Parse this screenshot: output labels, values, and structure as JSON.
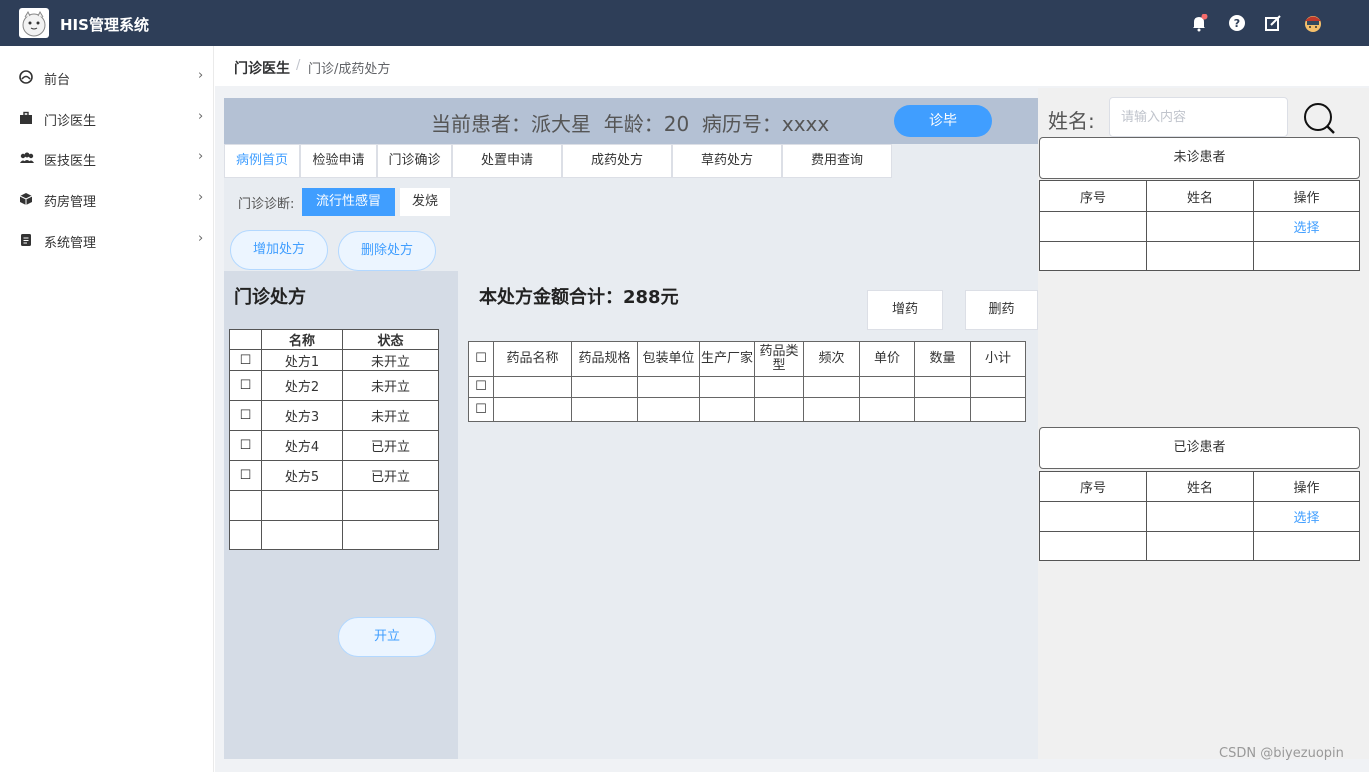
{
  "app": {
    "title": "HIS管理系统",
    "watermark": "CSDN @biyezuopin"
  },
  "sidebar": {
    "items": [
      {
        "label": "前台",
        "icon": "dashboard-icon"
      },
      {
        "label": "门诊医生",
        "icon": "briefcase-icon"
      },
      {
        "label": "医技医生",
        "icon": "users-icon"
      },
      {
        "label": "药房管理",
        "icon": "box-icon"
      },
      {
        "label": "系统管理",
        "icon": "document-icon"
      }
    ]
  },
  "breadcrumb": {
    "root": "门诊医生",
    "separator": "/",
    "current": "门诊/成药处方"
  },
  "patient": {
    "info": "当前患者：派大星  年龄：20  病历号：xxxx",
    "finish_label": "诊毕"
  },
  "tabs": [
    "病例首页",
    "检验申请",
    "门诊确诊",
    "处置申请",
    "成药处方",
    "草药处方",
    "费用查询"
  ],
  "diagnosis": {
    "label": "门诊诊断:",
    "chips": [
      "流行性感冒",
      "发烧"
    ]
  },
  "actions": {
    "add_rx": "增加处方",
    "delete_rx": "删除处方",
    "issue": "开立"
  },
  "rx_panel": {
    "title": "门诊处方",
    "headers": [
      "名称",
      "状态"
    ],
    "rows": [
      {
        "name": "处方1",
        "status": "未开立"
      },
      {
        "name": "处方2",
        "status": "未开立"
      },
      {
        "name": "处方3",
        "status": "未开立"
      },
      {
        "name": "处方4",
        "status": "已开立"
      },
      {
        "name": "处方5",
        "status": "已开立"
      }
    ],
    "checkbox": "☐"
  },
  "drug_panel": {
    "total": "本处方金额合计：288元",
    "add_drug": "增药",
    "delete_drug": "删药",
    "headers": [
      "药品名称",
      "药品规格",
      "包装单位",
      "生产厂家",
      "药品类型",
      "频次",
      "单价",
      "数量",
      "小计"
    ],
    "checkbox": "☐"
  },
  "search": {
    "label": "姓名:",
    "placeholder": "请输入内容"
  },
  "pending": {
    "title": "未诊患者",
    "headers": [
      "序号",
      "姓名",
      "操作"
    ],
    "select_label": "选择"
  },
  "done": {
    "title": "已诊患者",
    "headers": [
      "序号",
      "姓名",
      "操作"
    ],
    "select_label": "选择"
  }
}
